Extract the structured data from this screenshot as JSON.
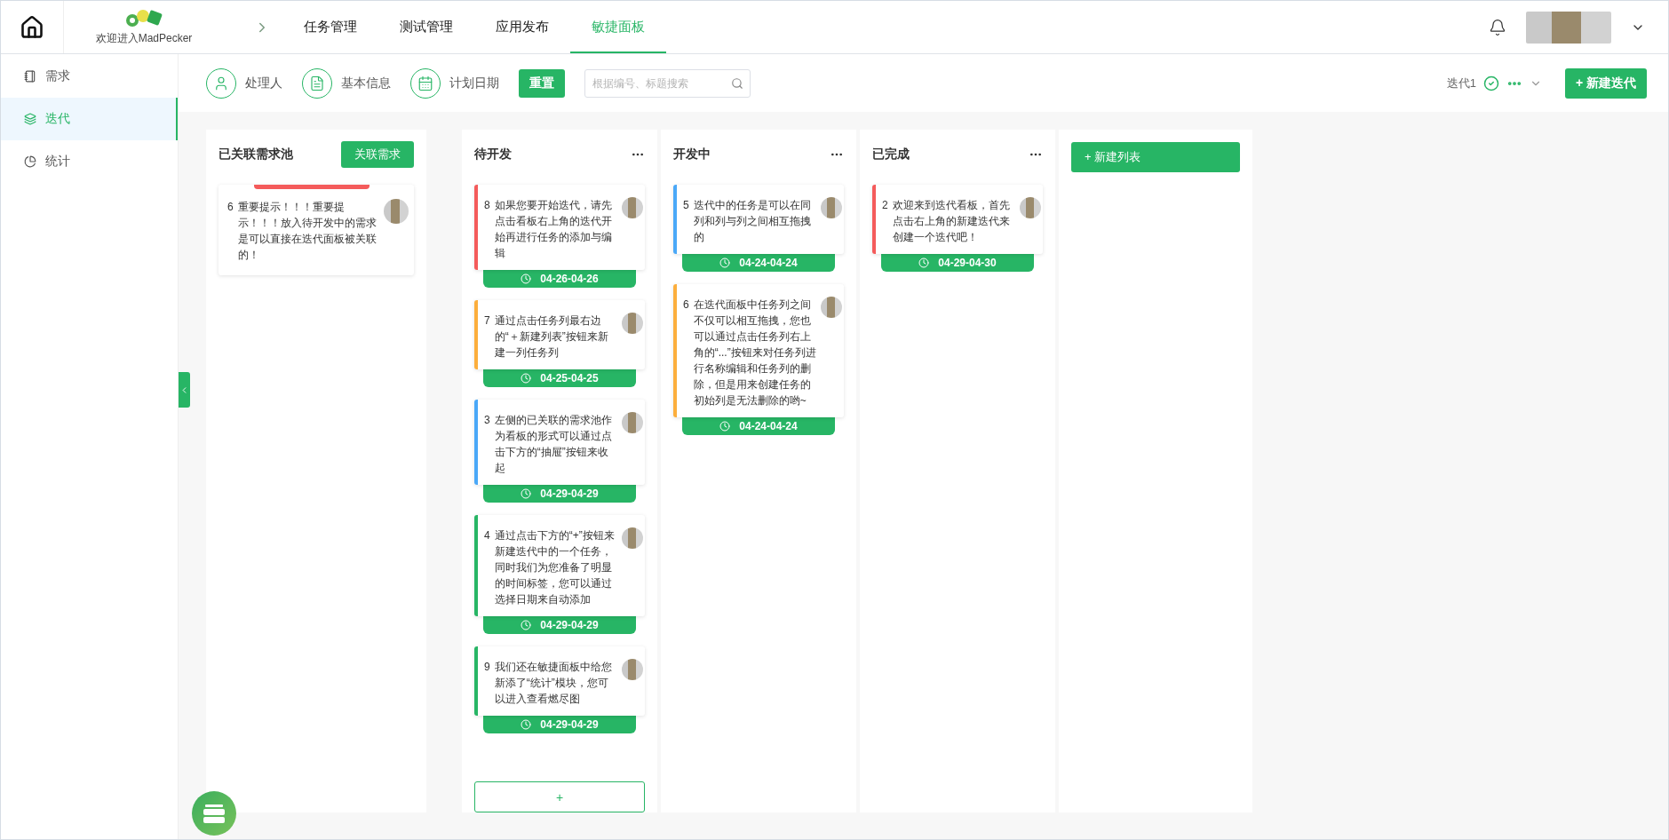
{
  "header": {
    "welcome": "欢迎进入MadPecker",
    "nav": [
      {
        "label": "任务管理",
        "selected": false
      },
      {
        "label": "测试管理",
        "selected": false
      },
      {
        "label": "应用发布",
        "selected": false
      },
      {
        "label": "敏捷面板",
        "selected": true
      }
    ]
  },
  "sidebar": {
    "items": [
      {
        "label": "需求",
        "kind": "list",
        "selected": false
      },
      {
        "label": "迭代",
        "kind": "stack",
        "selected": true
      },
      {
        "label": "统计",
        "kind": "pie",
        "selected": false
      }
    ]
  },
  "toolbar": {
    "filters": [
      {
        "label": "处理人",
        "kind": "person"
      },
      {
        "label": "基本信息",
        "kind": "doc"
      },
      {
        "label": "计划日期",
        "kind": "calendar"
      }
    ],
    "reset": "重置",
    "search": {
      "placeholder": "根据编号、标题搜索"
    },
    "iteration": "迭代1",
    "new_iteration": "+ 新建迭代"
  },
  "pool": {
    "title": "已关联需求池",
    "button": "关联需求",
    "cards": [
      {
        "id": "6",
        "text": "重要提示！！！重要提示！！！放入待开发中的需求是可以直接在迭代面板被关联的！",
        "color": "#f45b5b"
      }
    ]
  },
  "columns": [
    {
      "title": "待开发",
      "add": "+",
      "cards": [
        {
          "id": "8",
          "text": "如果您要开始迭代，请先点击看板右上角的迭代开始再进行任务的添加与编辑",
          "color": "#f45b5b",
          "date": "04-26-04-26"
        },
        {
          "id": "7",
          "text": "通过点击任务列最右边的“＋新建列表”按钮来新建一列任务列",
          "color": "#fcae3c",
          "date": "04-25-04-25"
        },
        {
          "id": "3",
          "text": "左侧的已关联的需求池作为看板的形式可以通过点击下方的“抽屉”按钮来收起",
          "color": "#4aa8f8",
          "date": "04-29-04-29"
        },
        {
          "id": "4",
          "text": "通过点击下方的“+”按钮来新建迭代中的一个任务，同时我们为您准备了明显的时间标签，您可以通过选择日期来自动添加",
          "color": "#27b565",
          "date": "04-29-04-29"
        },
        {
          "id": "9",
          "text": "我们还在敏捷面板中给您新添了“统计”模块，您可以进入查看燃尽图",
          "color": "#27b565",
          "date": "04-29-04-29"
        }
      ]
    },
    {
      "title": "开发中",
      "cards": [
        {
          "id": "5",
          "text": "迭代中的任务是可以在同列和列与列之间相互拖拽的",
          "color": "#4aa8f8",
          "date": "04-24-04-24"
        },
        {
          "id": "6",
          "text": "在迭代面板中任务列之间不仅可以相互拖拽，您也可以通过点击任务列右上角的“...”按钮来对任务列进行名称编辑和任务列的删除，但是用来创建任务的初始列是无法删除的哟~",
          "color": "#fcae3c",
          "date": "04-24-04-24"
        }
      ]
    },
    {
      "title": "已完成",
      "cards": [
        {
          "id": "2",
          "text": "欢迎来到迭代看板，首先点击右上角的新建迭代来创建一个迭代吧！",
          "color": "#f45b5b",
          "date": "04-29-04-30"
        }
      ]
    }
  ],
  "new_list": "+ 新建列表"
}
